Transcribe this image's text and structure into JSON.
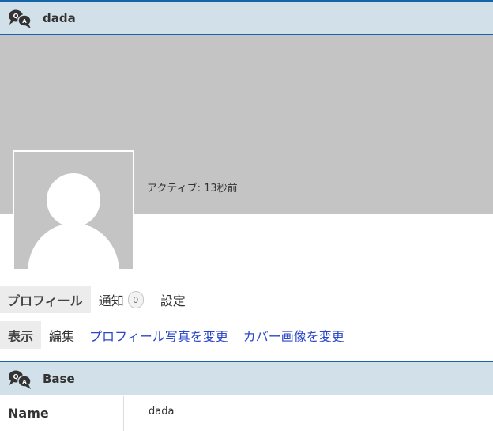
{
  "header": {
    "title": "dada",
    "icon": "qa-chat-icon"
  },
  "profile": {
    "last_active": "アクティブ: 13秒前",
    "cover_color": "#c4c4c4"
  },
  "tabs": [
    {
      "label": "プロフィール",
      "active": true
    },
    {
      "label": "通知",
      "count": "0"
    },
    {
      "label": "設定"
    }
  ],
  "subnav": [
    {
      "label": "表示",
      "active": true
    },
    {
      "label": "編集"
    },
    {
      "label": "プロフィール写真を変更"
    },
    {
      "label": "カバー画像を変更"
    }
  ],
  "base_section": {
    "title": "Base",
    "fields": [
      {
        "label": "Name",
        "value": "dada"
      }
    ]
  },
  "colors": {
    "accent_border": "#1565a8",
    "header_bg": "#d1e0e9",
    "link": "#2b47c9"
  }
}
